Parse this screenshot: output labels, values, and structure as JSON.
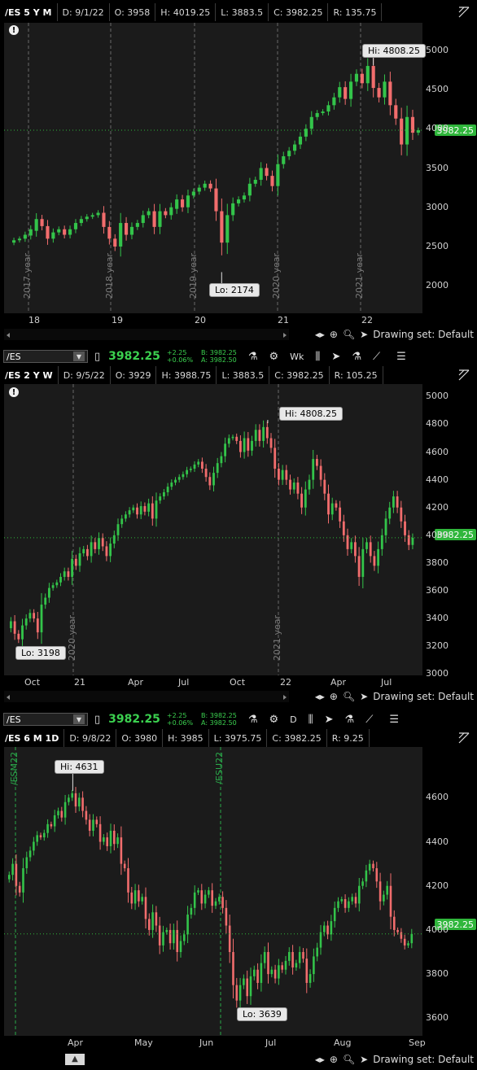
{
  "panels": [
    {
      "symbol": "/ES 5 Y M",
      "info": [
        "D: 9/1/22",
        "O: 3958",
        "H: 4019.25",
        "L: 3883.5",
        "C: 3982.25",
        "R: 135.75"
      ],
      "last_price": "3982.25",
      "y_ticks": [
        "5000",
        "4500",
        "4000",
        "3500",
        "3000",
        "2500",
        "2000"
      ],
      "x_ticks": [
        "18",
        "19",
        "20",
        "21",
        "22"
      ],
      "year_marks": [
        "2017 year",
        "2018 year",
        "2019 year",
        "2020 year",
        "2021 year"
      ],
      "hi_label": "Hi: 4808.25",
      "lo_label": "Lo: 2174",
      "drawing_set": "Drawing set: Default",
      "candles": [
        [
          2550,
          2580
        ],
        [
          2580,
          2600
        ],
        [
          2600,
          2650
        ],
        [
          2640,
          2720
        ],
        [
          2700,
          2850
        ],
        [
          2850,
          2760
        ],
        [
          2760,
          2600
        ],
        [
          2600,
          2680
        ],
        [
          2680,
          2720
        ],
        [
          2720,
          2650
        ],
        [
          2650,
          2720
        ],
        [
          2720,
          2800
        ],
        [
          2800,
          2850
        ],
        [
          2850,
          2880
        ],
        [
          2880,
          2900
        ],
        [
          2900,
          2930
        ],
        [
          2930,
          2750
        ],
        [
          2750,
          2600
        ],
        [
          2600,
          2500
        ],
        [
          2500,
          2800
        ],
        [
          2800,
          2650
        ],
        [
          2650,
          2750
        ],
        [
          2750,
          2800
        ],
        [
          2800,
          2900
        ],
        [
          2900,
          2950
        ],
        [
          2950,
          2750
        ],
        [
          2750,
          2950
        ],
        [
          2950,
          2900
        ],
        [
          2900,
          3000
        ],
        [
          2980,
          3100
        ],
        [
          3100,
          3000
        ],
        [
          3000,
          3150
        ],
        [
          3150,
          3200
        ],
        [
          3200,
          3250
        ],
        [
          3250,
          3300
        ],
        [
          3300,
          3240
        ],
        [
          3240,
          2950
        ],
        [
          2950,
          2550
        ],
        [
          2550,
          2900
        ],
        [
          2900,
          3050
        ],
        [
          3050,
          3100
        ],
        [
          3100,
          3150
        ],
        [
          3150,
          3300
        ],
        [
          3300,
          3350
        ],
        [
          3350,
          3500
        ],
        [
          3500,
          3400
        ],
        [
          3400,
          3270
        ],
        [
          3270,
          3550
        ],
        [
          3550,
          3650
        ],
        [
          3650,
          3720
        ],
        [
          3720,
          3800
        ],
        [
          3800,
          3900
        ],
        [
          3900,
          4000
        ],
        [
          4000,
          4150
        ],
        [
          4150,
          4200
        ],
        [
          4200,
          4220
        ],
        [
          4220,
          4300
        ],
        [
          4300,
          4400
        ],
        [
          4400,
          4530
        ],
        [
          4530,
          4380
        ],
        [
          4380,
          4600
        ],
        [
          4600,
          4700
        ],
        [
          4700,
          4580
        ],
        [
          4580,
          4800
        ],
        [
          4800,
          4520
        ],
        [
          4520,
          4400
        ],
        [
          4400,
          4600
        ],
        [
          4600,
          4300
        ],
        [
          4300,
          4130
        ],
        [
          4130,
          3800
        ],
        [
          3800,
          4150
        ],
        [
          4150,
          3950
        ],
        [
          3950,
          3982
        ]
      ]
    },
    {
      "symbol": "/ES 2 Y W",
      "info": [
        "D: 9/5/22",
        "O: 3929",
        "H: 3988.75",
        "L: 3883.5",
        "C: 3982.25",
        "R: 105.25"
      ],
      "last_price": "3982.25",
      "y_ticks": [
        "5000",
        "4800",
        "4600",
        "4400",
        "4200",
        "4000",
        "3800",
        "3600",
        "3400",
        "3200",
        "3000"
      ],
      "x_ticks": [
        "Oct",
        "21",
        "Apr",
        "Jul",
        "Oct",
        "22",
        "Apr",
        "Jul"
      ],
      "year_marks": [
        "2020 year",
        "2021 year"
      ],
      "hi_label": "Hi: 4808.25",
      "lo_label": "Lo: 3198",
      "drawing_set": "Drawing set: Default",
      "candles": [
        [
          3330,
          3380
        ],
        [
          3380,
          3290
        ],
        [
          3290,
          3250
        ],
        [
          3250,
          3350
        ],
        [
          3350,
          3400
        ],
        [
          3400,
          3440
        ],
        [
          3440,
          3400
        ],
        [
          3400,
          3300
        ],
        [
          3300,
          3500
        ],
        [
          3500,
          3550
        ],
        [
          3550,
          3620
        ],
        [
          3620,
          3640
        ],
        [
          3640,
          3660
        ],
        [
          3660,
          3700
        ],
        [
          3700,
          3740
        ],
        [
          3740,
          3700
        ],
        [
          3700,
          3830
        ],
        [
          3830,
          3780
        ],
        [
          3780,
          3870
        ],
        [
          3870,
          3900
        ],
        [
          3900,
          3850
        ],
        [
          3850,
          3950
        ],
        [
          3950,
          3900
        ],
        [
          3900,
          3980
        ],
        [
          3980,
          3920
        ],
        [
          3920,
          3850
        ],
        [
          3850,
          3940
        ],
        [
          3940,
          4000
        ],
        [
          4000,
          4080
        ],
        [
          4080,
          4120
        ],
        [
          4120,
          4150
        ],
        [
          4150,
          4180
        ],
        [
          4180,
          4200
        ],
        [
          4200,
          4150
        ],
        [
          4150,
          4210
        ],
        [
          4210,
          4170
        ],
        [
          4170,
          4230
        ],
        [
          4230,
          4120
        ],
        [
          4120,
          4250
        ],
        [
          4250,
          4280
        ],
        [
          4280,
          4310
        ],
        [
          4310,
          4350
        ],
        [
          4350,
          4380
        ],
        [
          4380,
          4400
        ],
        [
          4400,
          4420
        ],
        [
          4420,
          4440
        ],
        [
          4440,
          4470
        ],
        [
          4470,
          4480
        ],
        [
          4480,
          4510
        ],
        [
          4510,
          4530
        ],
        [
          4530,
          4480
        ],
        [
          4480,
          4420
        ],
        [
          4420,
          4360
        ],
        [
          4360,
          4450
        ],
        [
          4450,
          4520
        ],
        [
          4520,
          4570
        ],
        [
          4570,
          4660
        ],
        [
          4660,
          4700
        ],
        [
          4700,
          4710
        ],
        [
          4710,
          4680
        ],
        [
          4680,
          4600
        ],
        [
          4600,
          4700
        ],
        [
          4700,
          4610
        ],
        [
          4610,
          4680
        ],
        [
          4680,
          4760
        ],
        [
          4760,
          4680
        ],
        [
          4680,
          4780
        ],
        [
          4780,
          4700
        ],
        [
          4700,
          4630
        ],
        [
          4630,
          4480
        ],
        [
          4480,
          4400
        ],
        [
          4400,
          4470
        ],
        [
          4470,
          4400
        ],
        [
          4400,
          4330
        ],
        [
          4330,
          4380
        ],
        [
          4380,
          4300
        ],
        [
          4300,
          4200
        ],
        [
          4200,
          4330
        ],
        [
          4330,
          4400
        ],
        [
          4400,
          4550
        ],
        [
          4550,
          4500
        ],
        [
          4500,
          4400
        ],
        [
          4400,
          4300
        ],
        [
          4300,
          4150
        ],
        [
          4150,
          4230
        ],
        [
          4230,
          4200
        ],
        [
          4200,
          4100
        ],
        [
          4100,
          4000
        ],
        [
          4000,
          3900
        ],
        [
          3900,
          3950
        ],
        [
          3950,
          3850
        ],
        [
          3850,
          3700
        ],
        [
          3700,
          3900
        ],
        [
          3900,
          3950
        ],
        [
          3950,
          3850
        ],
        [
          3850,
          3780
        ],
        [
          3780,
          3900
        ],
        [
          3900,
          4000
        ],
        [
          4000,
          4120
        ],
        [
          4120,
          4200
        ],
        [
          4200,
          4280
        ],
        [
          4280,
          4200
        ],
        [
          4200,
          4100
        ],
        [
          4100,
          4000
        ],
        [
          4000,
          3930
        ],
        [
          3930,
          3982
        ]
      ]
    },
    {
      "symbol": "/ES 6 M 1D",
      "info": [
        "D: 9/8/22",
        "O: 3980",
        "H: 3985",
        "L: 3975.75",
        "C: 3982.25",
        "R: 9.25"
      ],
      "last_price": "3982.25",
      "y_ticks": [
        "4600",
        "4400",
        "4200",
        "4000",
        "3800",
        "3600"
      ],
      "x_ticks": [
        "Apr",
        "May",
        "Jun",
        "Jul",
        "Aug",
        "Sep"
      ],
      "year_marks": [
        "/ESM22",
        "/ESU22"
      ],
      "hi_label": "Hi: 4631",
      "lo_label": "Lo: 3639",
      "drawing_set": "Drawing set: Default",
      "candles": [
        [
          4230,
          4250
        ],
        [
          4250,
          4300
        ],
        [
          4300,
          4200
        ],
        [
          4200,
          4170
        ],
        [
          4170,
          4280
        ],
        [
          4280,
          4330
        ],
        [
          4330,
          4360
        ],
        [
          4360,
          4400
        ],
        [
          4400,
          4430
        ],
        [
          4430,
          4420
        ],
        [
          4420,
          4440
        ],
        [
          4440,
          4480
        ],
        [
          4480,
          4470
        ],
        [
          4470,
          4520
        ],
        [
          4520,
          4540
        ],
        [
          4540,
          4510
        ],
        [
          4510,
          4580
        ],
        [
          4580,
          4600
        ],
        [
          4600,
          4620
        ],
        [
          4620,
          4560
        ],
        [
          4560,
          4600
        ],
        [
          4600,
          4540
        ],
        [
          4540,
          4500
        ],
        [
          4500,
          4450
        ],
        [
          4450,
          4500
        ],
        [
          4500,
          4480
        ],
        [
          4480,
          4400
        ],
        [
          4400,
          4420
        ],
        [
          4420,
          4380
        ],
        [
          4380,
          4450
        ],
        [
          4450,
          4390
        ],
        [
          4390,
          4420
        ],
        [
          4420,
          4300
        ],
        [
          4300,
          4280
        ],
        [
          4280,
          4170
        ],
        [
          4170,
          4120
        ],
        [
          4120,
          4180
        ],
        [
          4180,
          4130
        ],
        [
          4130,
          4150
        ],
        [
          4150,
          4050
        ],
        [
          4050,
          4000
        ],
        [
          4000,
          4080
        ],
        [
          4080,
          4020
        ],
        [
          4020,
          3930
        ],
        [
          3930,
          3990
        ],
        [
          3990,
          4000
        ],
        [
          4000,
          3940
        ],
        [
          3940,
          4000
        ],
        [
          4000,
          3900
        ],
        [
          3900,
          3950
        ],
        [
          3950,
          3980
        ],
        [
          3980,
          4070
        ],
        [
          4070,
          4100
        ],
        [
          4100,
          4170
        ],
        [
          4170,
          4180
        ],
        [
          4180,
          4120
        ],
        [
          4120,
          4160
        ],
        [
          4160,
          4180
        ],
        [
          4180,
          4110
        ],
        [
          4110,
          4130
        ],
        [
          4130,
          4150
        ],
        [
          4150,
          4100
        ],
        [
          4100,
          4020
        ],
        [
          4020,
          3900
        ],
        [
          3900,
          3750
        ],
        [
          3750,
          3680
        ],
        [
          3680,
          3750
        ],
        [
          3750,
          3780
        ],
        [
          3780,
          3700
        ],
        [
          3700,
          3790
        ],
        [
          3790,
          3820
        ],
        [
          3820,
          3760
        ],
        [
          3760,
          3850
        ],
        [
          3850,
          3900
        ],
        [
          3900,
          3800
        ],
        [
          3800,
          3820
        ],
        [
          3820,
          3780
        ],
        [
          3780,
          3840
        ],
        [
          3840,
          3820
        ],
        [
          3820,
          3860
        ],
        [
          3860,
          3900
        ],
        [
          3900,
          3830
        ],
        [
          3830,
          3850
        ],
        [
          3850,
          3900
        ],
        [
          3900,
          3870
        ],
        [
          3870,
          3760
        ],
        [
          3760,
          3800
        ],
        [
          3800,
          3880
        ],
        [
          3880,
          3920
        ],
        [
          3920,
          3990
        ],
        [
          3990,
          4020
        ],
        [
          4020,
          3980
        ],
        [
          3980,
          4040
        ],
        [
          4040,
          4100
        ],
        [
          4100,
          4130
        ],
        [
          4130,
          4140
        ],
        [
          4140,
          4100
        ],
        [
          4100,
          4130
        ],
        [
          4130,
          4150
        ],
        [
          4150,
          4120
        ],
        [
          4120,
          4200
        ],
        [
          4200,
          4220
        ],
        [
          4220,
          4270
        ],
        [
          4270,
          4300
        ],
        [
          4300,
          4280
        ],
        [
          4280,
          4220
        ],
        [
          4220,
          4130
        ],
        [
          4130,
          4160
        ],
        [
          4160,
          4200
        ],
        [
          4200,
          4060
        ],
        [
          4060,
          4000
        ],
        [
          4000,
          3990
        ],
        [
          3990,
          3960
        ],
        [
          3960,
          3930
        ],
        [
          3930,
          3940
        ],
        [
          3940,
          3982
        ]
      ]
    }
  ],
  "toolbars": [
    {
      "symbol": "/ES",
      "price": "3982.25",
      "change": "+2.25",
      "change_pct": "+0.06%",
      "bid": "B: 3982.25",
      "ask": "A: 3982.50",
      "aggregation": "Wk"
    },
    {
      "symbol": "/ES",
      "price": "3982.25",
      "change": "+2.25",
      "change_pct": "+0.06%",
      "bid": "B: 3982.25",
      "ask": "A: 3982.50",
      "aggregation": "D"
    }
  ],
  "colors": {
    "up": "#33c44a",
    "down": "#f26d6d",
    "price_badge": "#2fb63b",
    "plot_bg": "#1b1b1b"
  },
  "icons": [
    "alert-icon",
    "collapse-icon",
    "beaker-icon",
    "gear-icon",
    "candle-icon",
    "cursor-icon",
    "drawing-icon",
    "menu-icon",
    "zoom-icon",
    "crosshair-icon",
    "pan-icon"
  ]
}
